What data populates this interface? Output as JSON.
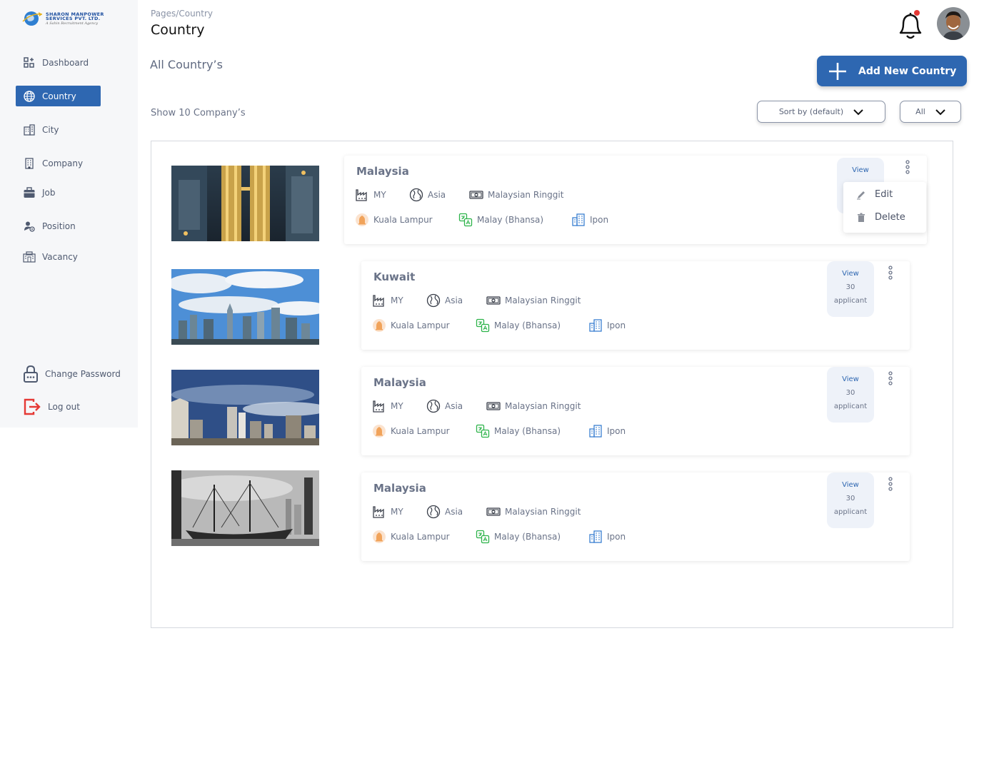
{
  "brand": {
    "line1": "SHARON MANPOWER",
    "line2": "SERVICES PVT. LTD.",
    "tagline": "A Sahin Recruitment Agency"
  },
  "sidebar": {
    "items": [
      {
        "label": "Dashboard",
        "icon": "dashboard-icon"
      },
      {
        "label": "Country",
        "icon": "globe-icon"
      },
      {
        "label": "City",
        "icon": "city-icon"
      },
      {
        "label": "Company",
        "icon": "company-icon"
      },
      {
        "label": "Job",
        "icon": "briefcase-icon"
      },
      {
        "label": "Position",
        "icon": "position-icon"
      },
      {
        "label": "Vacancy",
        "icon": "vacancy-icon"
      }
    ],
    "change_password": "Change Password",
    "logout": "Log out"
  },
  "header": {
    "breadcrumb": "Pages/Country",
    "title": "Country"
  },
  "main": {
    "section_title": "All Country’s",
    "add_button": "Add New Country",
    "show_label": "Show 10 Company’s",
    "sort_label": "Sort by (default)",
    "filter_label": "All"
  },
  "cards": [
    {
      "name": "Malaysia",
      "code": "MY",
      "continent": "Asia",
      "currency": "Malaysian Ringgit",
      "capital": "Kuala Lampur",
      "language": "Malay (Bhansa)",
      "city": "Ipon",
      "view": "View",
      "count": "",
      "unit": ""
    },
    {
      "name": "Kuwait",
      "code": "MY",
      "continent": "Asia",
      "currency": "Malaysian Ringgit",
      "capital": "Kuala Lampur",
      "language": "Malay (Bhansa)",
      "city": "Ipon",
      "view": "View",
      "count": "30",
      "unit": "applicant"
    },
    {
      "name": "Malaysia",
      "code": "MY",
      "continent": "Asia",
      "currency": "Malaysian Ringgit",
      "capital": "Kuala Lampur",
      "language": "Malay (Bhansa)",
      "city": "Ipon",
      "view": "View",
      "count": "30",
      "unit": "applicant"
    },
    {
      "name": "Malaysia",
      "code": "MY",
      "continent": "Asia",
      "currency": "Malaysian Ringgit",
      "capital": "Kuala Lampur",
      "language": "Malay (Bhansa)",
      "city": "Ipon",
      "view": "View",
      "count": "30",
      "unit": "applicant"
    }
  ],
  "menu": {
    "edit": "Edit",
    "delete": "Delete"
  },
  "colors": {
    "primary": "#2e67b1",
    "sidebar_bg": "#f6f7f9",
    "notification": "#e53935",
    "logout": "#e53935"
  }
}
